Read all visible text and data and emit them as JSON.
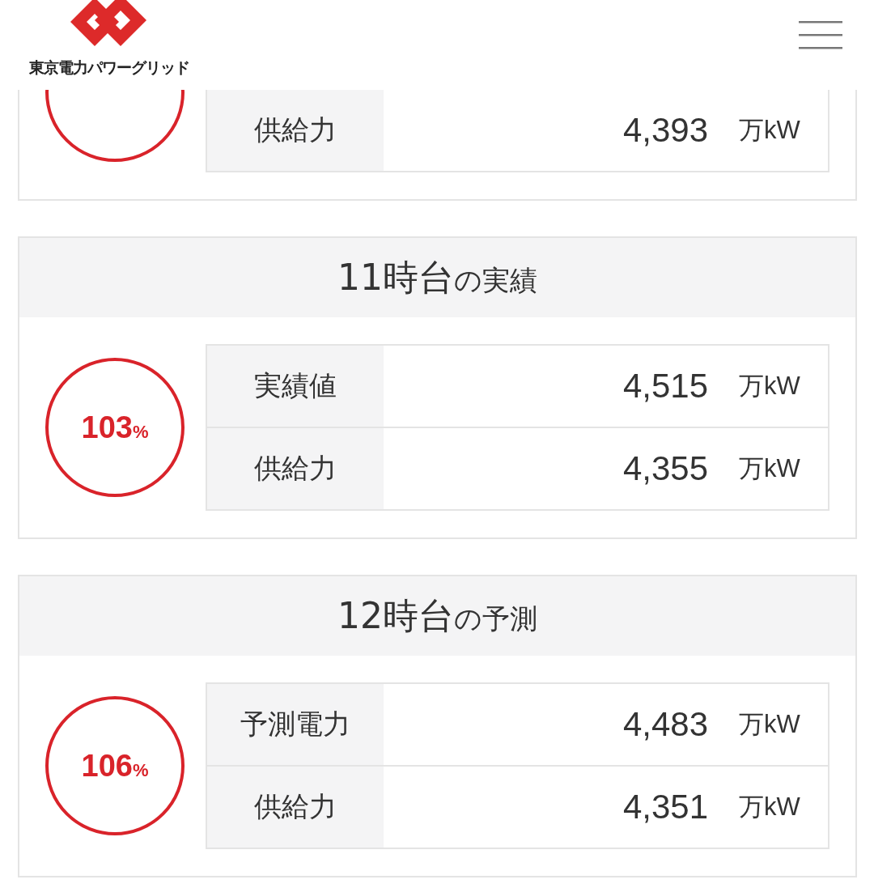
{
  "header": {
    "logo_text": "東京電力パワーグリッド"
  },
  "cards": [
    {
      "rows": [
        {
          "label": "供給力",
          "value": "4,393",
          "unit": "万kW"
        }
      ]
    },
    {
      "title_hour": "11時台",
      "title_suffix": "の実績",
      "percent": "103",
      "percent_unit": "%",
      "rows": [
        {
          "label": "実績値",
          "value": "4,515",
          "unit": "万kW"
        },
        {
          "label": "供給力",
          "value": "4,355",
          "unit": "万kW"
        }
      ]
    },
    {
      "title_hour": "12時台",
      "title_suffix": "の予測",
      "percent": "106",
      "percent_unit": "%",
      "rows": [
        {
          "label": "予測電力",
          "value": "4,483",
          "unit": "万kW"
        },
        {
          "label": "供給力",
          "value": "4,351",
          "unit": "万kW"
        }
      ]
    }
  ]
}
